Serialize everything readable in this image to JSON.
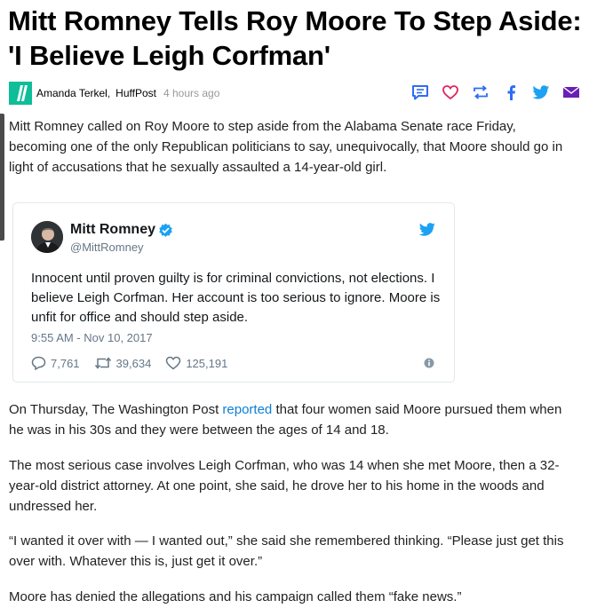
{
  "article": {
    "headline": "Mitt Romney Tells Roy Moore To Step Aside: 'I Believe Leigh Corfman'",
    "author": "Amanda Terkel",
    "outlet": "HuffPost",
    "time_ago": "4 hours ago",
    "paragraphs": {
      "p1": "Mitt Romney called on Roy Moore to step aside from the Alabama Senate race Friday, becoming one of the only Republican politicians to say, unequivocally, that Moore should go in light of accusations that he sexually assaulted a 14-year-old girl.",
      "p2_before": "On Thursday, The Washington Post ",
      "p2_link": "reported",
      "p2_after": " that four women said Moore pursued them when he was in his 30s and they were between the ages of 14 and 18.",
      "p3": "The most serious case involves Leigh Corfman, who was 14 when she met Moore, then a 32-year-old district attorney. At one point, she said, he drove her to his home in the woods and undressed her.",
      "p4": "“I wanted it over with — I wanted out,” she said she remembered thinking. “Please just get this over with. Whatever this is, just get it over.”",
      "p5": "Moore has denied the allegations and his campaign called them “fake news.”"
    }
  },
  "share": {
    "icons": [
      "comment-icon",
      "heart-icon",
      "retweet-icon",
      "facebook-icon",
      "twitter-icon",
      "email-icon"
    ],
    "colors": {
      "comment": "#2e6cf6",
      "heart": "#e0245e",
      "retweet": "#2e6cf6",
      "facebook": "#2e6cf6",
      "twitter": "#1da1f2",
      "email": "#6a1fb5"
    }
  },
  "tweet": {
    "name": "Mitt Romney",
    "handle": "@MittRomney",
    "text": "Innocent until proven guilty is for criminal convictions, not elections. I believe Leigh Corfman. Her account is too serious to ignore. Moore is unfit for office and should step aside.",
    "timestamp": "9:55 AM - Nov 10, 2017",
    "replies": "7,761",
    "retweets": "39,634",
    "likes": "125,191"
  },
  "colors": {
    "link": "#0b7fd6",
    "huffpost_green": "#0dbe98",
    "twitter_blue": "#1da1f2"
  }
}
